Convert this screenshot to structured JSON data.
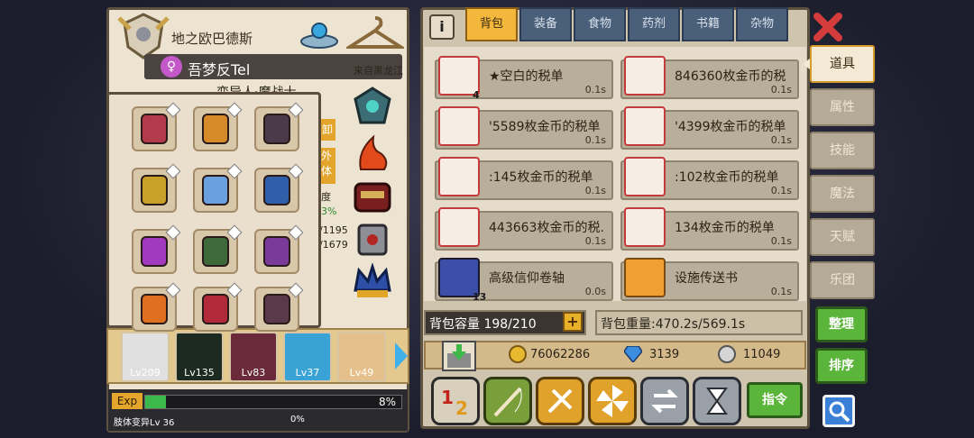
{
  "character": {
    "name": "地之欧巴德斯",
    "player_name": "吾梦反Tel",
    "origin": "来自黑龙江",
    "title_partial": "变异人·魔战士",
    "side_tags": [
      "卸",
      "外",
      "体"
    ],
    "partial_stats": [
      "度",
      "3%",
      "/1195",
      "/1679"
    ]
  },
  "heroes": [
    {
      "level": "Lv209"
    },
    {
      "level": "Lv135"
    },
    {
      "level": "Lv83"
    },
    {
      "level": "Lv37"
    },
    {
      "level": "Lv49"
    }
  ],
  "exp": {
    "label": "Exp",
    "percent": "8%",
    "fill": 0.08
  },
  "sub_exp": {
    "label": "肢体变异Lv 36",
    "percent": "0%"
  },
  "tabs": [
    "背包",
    "装备",
    "食物",
    "药剂",
    "书籍",
    "杂物"
  ],
  "info_icon": "i",
  "items": [
    {
      "name": "★空白的税单",
      "weight": "0.1s",
      "qty": "4"
    },
    {
      "name": "846360枚金币的税",
      "weight": "0.1s",
      "qty": ""
    },
    {
      "name": "'5589枚金币的税单",
      "weight": "0.1s",
      "qty": ""
    },
    {
      "name": "'4399枚金币的税单",
      "weight": "0.1s",
      "qty": ""
    },
    {
      "name": ":145枚金币的税单",
      "weight": "0.1s",
      "qty": ""
    },
    {
      "name": ":102枚金币的税单",
      "weight": "0.1s",
      "qty": ""
    },
    {
      "name": "443663枚金币的税.",
      "weight": "0.1s",
      "qty": ""
    },
    {
      "name": "134枚金币的税单",
      "weight": "0.1s",
      "qty": ""
    },
    {
      "name": "高级信仰卷轴",
      "weight": "0.0s",
      "qty": "13"
    },
    {
      "name": "设施传送书",
      "weight": "0.1s",
      "qty": ""
    }
  ],
  "capacity": "背包容量 198/210",
  "weight": "背包重量:470.2s/569.1s",
  "currency": {
    "gold": "76062286",
    "gem": "3139",
    "coin": "11049"
  },
  "side_tabs": [
    "道具",
    "属性",
    "技能",
    "魔法",
    "天赋",
    "乐团"
  ],
  "buttons": {
    "organize": "整理",
    "sort": "排序",
    "command": "指令"
  },
  "colors": {
    "accent": "#f2b73b",
    "close": "#d43c3c",
    "green": "#5cb53b"
  }
}
